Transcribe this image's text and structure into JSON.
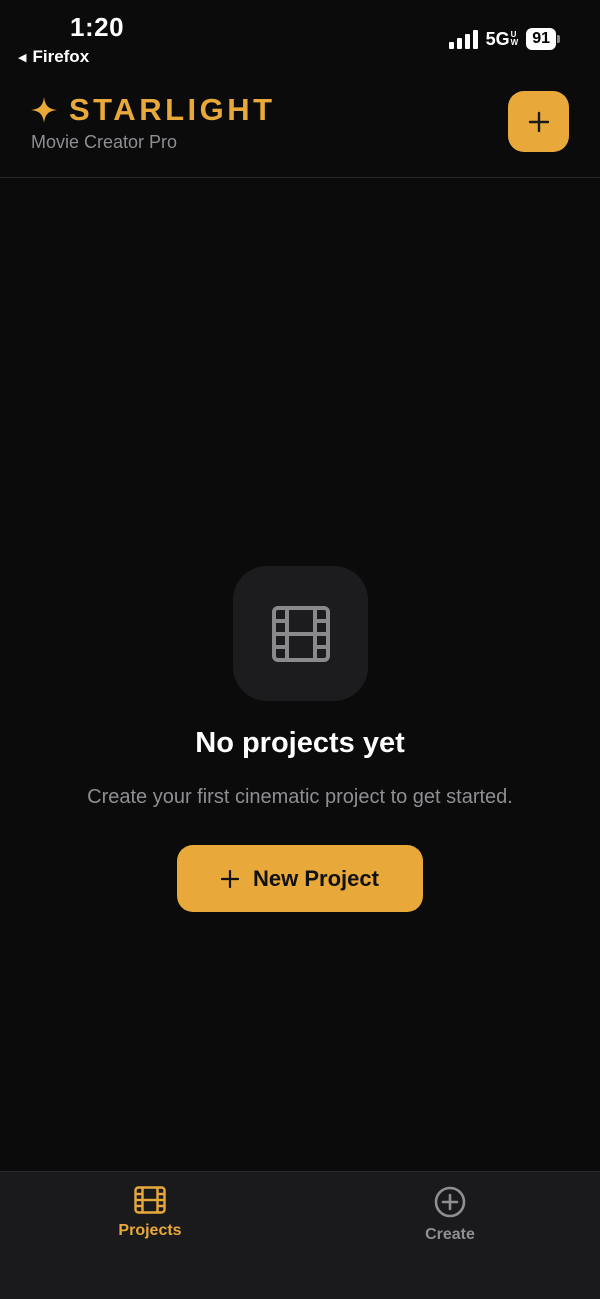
{
  "status_bar": {
    "time": "1:20",
    "back_label": "Firefox",
    "network": "5G",
    "network_sub": [
      "U",
      "W"
    ],
    "battery": "91"
  },
  "header": {
    "title": "STARLIGHT",
    "subtitle": "Movie Creator Pro",
    "add_icon": "plus-icon"
  },
  "empty_state": {
    "icon": "film-icon",
    "title": "No projects yet",
    "description": "Create your first cinematic project to get started.",
    "button_label": "New Project"
  },
  "tab_bar": {
    "tabs": [
      {
        "label": "Projects",
        "icon": "film-icon",
        "active": true
      },
      {
        "label": "Create",
        "icon": "plus-circle-icon",
        "active": false
      }
    ]
  },
  "colors": {
    "accent": "#e8a93a",
    "background": "#0b0b0c",
    "muted_text": "#8e8e93",
    "inactive_tab": "#8e8e93"
  }
}
